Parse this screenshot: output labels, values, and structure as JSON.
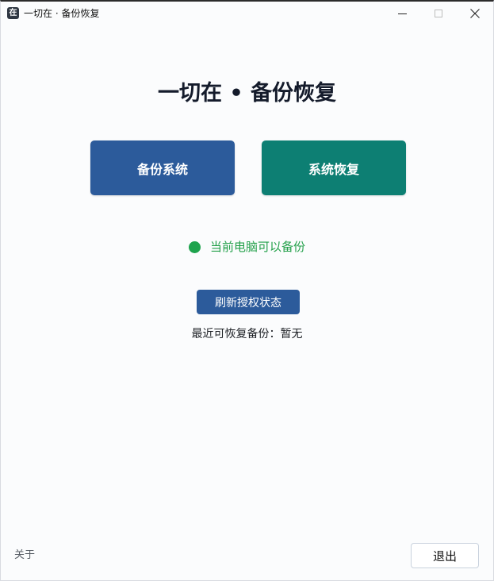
{
  "window": {
    "title": "一切在 · 备份恢复",
    "app_icon_glyph": "在"
  },
  "main": {
    "heading": "一切在 • 备份恢复",
    "backup_label": "备份系统",
    "restore_label": "系统恢复",
    "status_text": "当前电脑可以备份",
    "refresh_label": "刷新授权状态",
    "recent_label": "最近可恢复备份：暂无"
  },
  "footer": {
    "about_label": "关于",
    "exit_label": "退出"
  },
  "colors": {
    "primary_blue": "#2c5b9b",
    "teal": "#0d7f73",
    "status_green": "#1ea34d",
    "heading": "#141b2b"
  },
  "icons": {
    "minimize": "minimize-icon",
    "maximize": "maximize-icon",
    "close": "close-icon",
    "status": "status-dot-icon"
  }
}
